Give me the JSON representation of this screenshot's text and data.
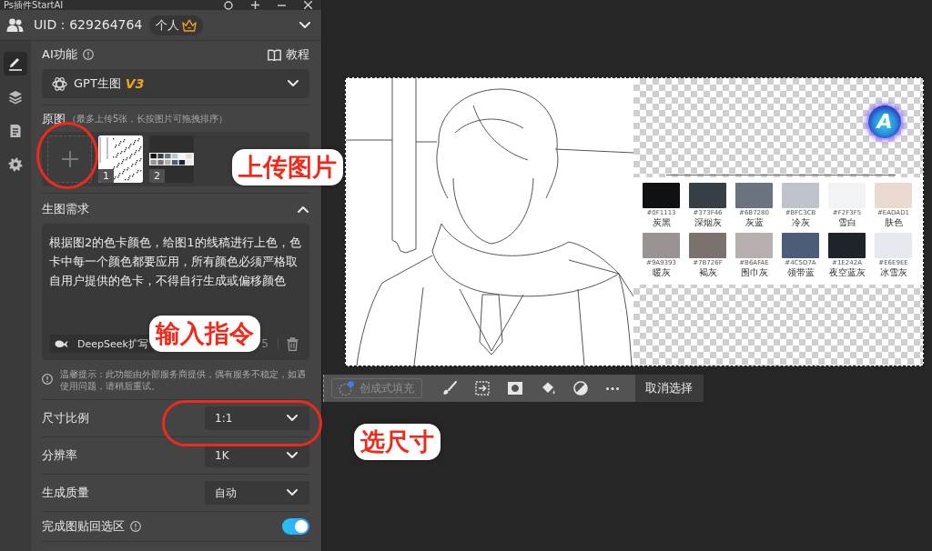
{
  "window": {
    "title": "Ps插件StartAI"
  },
  "account": {
    "uid": "UID：629264764",
    "plan": "个人"
  },
  "sidebar": {
    "items": [
      {
        "selected": true
      },
      {
        "selected": false
      },
      {
        "selected": false
      },
      {
        "selected": false
      }
    ]
  },
  "ai_function": {
    "label": "AI功能",
    "tutorial": "教程",
    "model": "GPT生图",
    "version": "V3"
  },
  "source_images": {
    "label": "原图",
    "hint": "（最多上传5张，长按图片可拖拽排序）",
    "thumbnails": [
      {
        "kind": "sketch",
        "number": "1"
      },
      {
        "kind": "palette",
        "number": "2"
      }
    ]
  },
  "prompt": {
    "label": "生图需求",
    "expanded": true,
    "value": "根据图2的色卡颜色，给图1的线稿进行上色，色卡中每一个颜色都要应用，所有颜色必须严格取自用户提供的色卡，不得自行生成或偏移颜色",
    "expand_button": "DeepSeek扩写",
    "count": "5"
  },
  "notice": "温馨提示：此功能由外部服务商提供，偶有服务不稳定，如遇使用问题，请稍后重试。",
  "settings": [
    {
      "kind": "select",
      "label": "尺寸比例",
      "value": "1:1"
    },
    {
      "kind": "select",
      "label": "分辨率",
      "value": "1K"
    },
    {
      "kind": "select",
      "label": "生成质量",
      "value": "自动"
    },
    {
      "kind": "toggle",
      "label": "完成图贴回选区",
      "on": true
    }
  ],
  "canvas": {
    "logo": "A",
    "swatches": [
      {
        "hex": "#0F1113",
        "name": "炭黑",
        "color": "#0f1113"
      },
      {
        "hex": "#373F46",
        "name": "深烟灰",
        "color": "#373f46"
      },
      {
        "hex": "#6B7280",
        "name": "灰蓝",
        "color": "#6b7280"
      },
      {
        "hex": "#BFC3CB",
        "name": "冷灰",
        "color": "#bfc3cb"
      },
      {
        "hex": "#F2F3F5",
        "name": "雪白",
        "color": "#f2f3f5"
      },
      {
        "hex": "#EADAD1",
        "name": "肤色",
        "color": "#eadad1"
      },
      {
        "hex": "#9A9393",
        "name": "暖灰",
        "color": "#9a9393"
      },
      {
        "hex": "#7B726F",
        "name": "褐灰",
        "color": "#7b726f"
      },
      {
        "hex": "#B6AFAE",
        "name": "围巾灰",
        "color": "#b6afae"
      },
      {
        "hex": "#4C5D7A",
        "name": "领带蓝",
        "color": "#4c5d7a"
      },
      {
        "hex": "#1E242A",
        "name": "夜空蓝灰",
        "color": "#1e242a"
      },
      {
        "hex": "#E6E9EE",
        "name": "冰雪灰",
        "color": "#e6e9ee"
      }
    ]
  },
  "toolbar": {
    "generative_fill": {
      "label": "创成式填充",
      "disabled": true
    },
    "deselect": "取消选择"
  },
  "annotations": [
    {
      "text": "上传图片"
    },
    {
      "text": "输入指令"
    },
    {
      "text": "选尺寸"
    }
  ]
}
